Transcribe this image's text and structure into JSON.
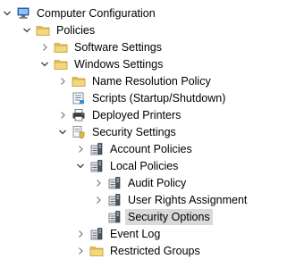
{
  "tree": {
    "partial_top": "",
    "items": [
      {
        "label": "Computer Configuration",
        "icon": "computer-icon",
        "state": "expanded"
      },
      {
        "label": "Policies",
        "icon": "folder-icon",
        "state": "expanded"
      },
      {
        "label": "Software Settings",
        "icon": "folder-icon",
        "state": "collapsed"
      },
      {
        "label": "Windows Settings",
        "icon": "folder-icon",
        "state": "expanded"
      },
      {
        "label": "Name Resolution Policy",
        "icon": "folder-icon",
        "state": "collapsed"
      },
      {
        "label": "Scripts (Startup/Shutdown)",
        "icon": "scripts-icon",
        "state": "leaf"
      },
      {
        "label": "Deployed Printers",
        "icon": "printer-icon",
        "state": "collapsed"
      },
      {
        "label": "Security Settings",
        "icon": "security-settings-icon",
        "state": "expanded"
      },
      {
        "label": "Account Policies",
        "icon": "policy-icon",
        "state": "collapsed"
      },
      {
        "label": "Local Policies",
        "icon": "policy-icon",
        "state": "expanded"
      },
      {
        "label": "Audit Policy",
        "icon": "policy-icon",
        "state": "collapsed"
      },
      {
        "label": "User Rights Assignment",
        "icon": "policy-icon",
        "state": "collapsed"
      },
      {
        "label": "Security Options",
        "icon": "policy-icon",
        "state": "leaf",
        "selected": true
      },
      {
        "label": "Event Log",
        "icon": "policy-icon",
        "state": "collapsed"
      },
      {
        "label": "Restricted Groups",
        "icon": "folder-icon",
        "state": "collapsed"
      }
    ]
  },
  "colors": {
    "selection": "#d9d9d9",
    "folder": "#e8c25c",
    "arrow": "#404040"
  }
}
